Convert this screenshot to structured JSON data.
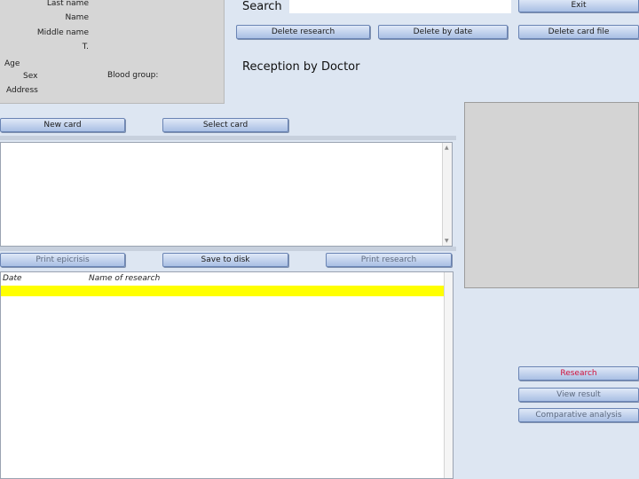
{
  "patient": {
    "labels": {
      "last_name": "Last name",
      "name": "Name",
      "middle_name": "Middle name",
      "t": "T.",
      "age": "Age",
      "sex": "Sex",
      "blood_group": "Blood group:",
      "address": "Address"
    }
  },
  "search": {
    "label": "Search",
    "value": ""
  },
  "toolbar": {
    "exit": "Exit",
    "delete_research": "Delete research",
    "delete_by_date": "Delete by date",
    "delete_card_file": "Delete card file"
  },
  "section_title": "Reception by Doctor",
  "card_buttons": {
    "new_card": "New card",
    "select_card": "Select card"
  },
  "action_buttons": {
    "print_epicrisis": "Print epicrisis",
    "save_to_disk": "Save to disk",
    "print_research": "Print research"
  },
  "grid": {
    "columns": [
      "Date",
      "Name of research"
    ],
    "rows": [
      [
        "",
        ""
      ]
    ]
  },
  "side_buttons": {
    "research": "Research",
    "view_result": "View result",
    "comparative_analysis": "Comparative analysis"
  }
}
